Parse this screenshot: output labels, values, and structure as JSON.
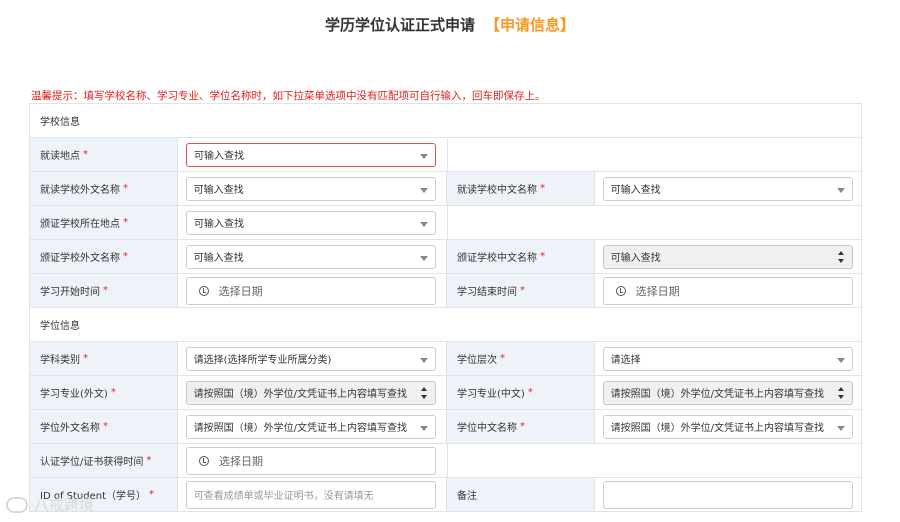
{
  "header": {
    "title": "学历学位认证正式申请",
    "subtitle": "【申请信息】"
  },
  "tip": "温馨提示：填写学校名称、学习专业、学位名称时，如下拉菜单选项中没有匹配项可自行输入，回车即保存上。",
  "sections": {
    "school": "学校信息",
    "degree": "学位信息"
  },
  "fields": {
    "study_location": {
      "label": "就读地点",
      "value": "可输入查找"
    },
    "school_foreign_name": {
      "label": "就读学校外文名称",
      "value": "可输入查找"
    },
    "school_chinese_name": {
      "label": "就读学校中文名称",
      "value": "可输入查找"
    },
    "issuer_location": {
      "label": "颁证学校所在地点",
      "value": "可输入查找"
    },
    "issuer_foreign_name": {
      "label": "颁证学校外文名称",
      "value": "可输入查找"
    },
    "issuer_chinese_name": {
      "label": "颁证学校中文名称",
      "value": "可输入查找"
    },
    "study_start": {
      "label": "学习开始时间",
      "value": "选择日期"
    },
    "study_end": {
      "label": "学习结束时间",
      "value": "选择日期"
    },
    "discipline": {
      "label": "学科类别",
      "value": "请选择(选择所学专业所属分类)"
    },
    "degree_level": {
      "label": "学位层次",
      "value": "请选择"
    },
    "major_foreign": {
      "label": "学习专业(外文)",
      "value": "请按照国（境）外学位/文凭证书上内容填写查找"
    },
    "major_chinese": {
      "label": "学习专业(中文)",
      "value": "请按照国（境）外学位/文凭证书上内容填写查找"
    },
    "degree_foreign_name": {
      "label": "学位外文名称",
      "value": "请按照国（境）外学位/文凭证书上内容填写查找"
    },
    "degree_chinese_name": {
      "label": "学位中文名称",
      "value": "请按照国（境）外学位/文凭证书上内容填写查找"
    },
    "degree_date": {
      "label": "认证学位/证书获得时间",
      "value": "选择日期"
    },
    "student_id": {
      "label": "ID of Student（学号）",
      "placeholder": "可查看成绩单或毕业证明书，没有请填无"
    },
    "remarks": {
      "label": "备注",
      "value": ""
    }
  },
  "required_mark": "*",
  "watermark": "八戒跨境",
  "colors": {
    "accent": "#f59a23",
    "warning": "#e02020",
    "label_bg": "#eef3f9"
  }
}
